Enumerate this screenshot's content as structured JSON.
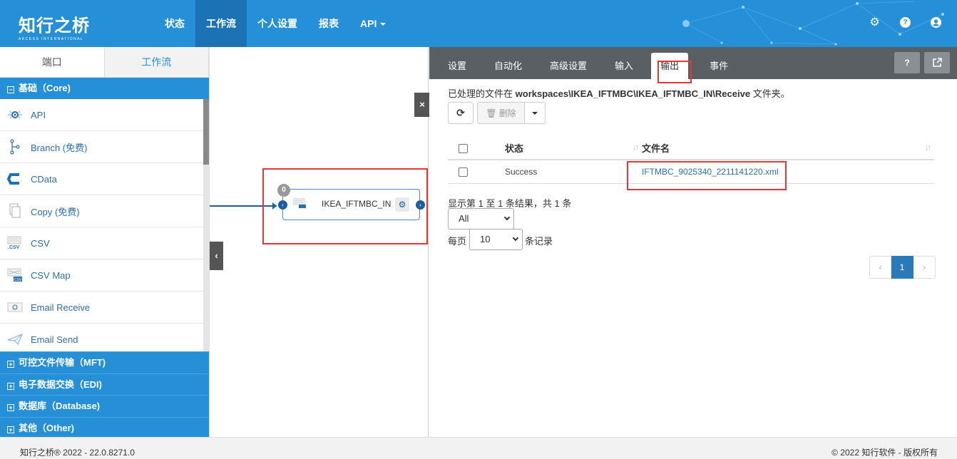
{
  "brand": {
    "name_cn": "知行之桥",
    "name_en": "AKCESS INTERNATIONAL"
  },
  "nav": {
    "items": [
      {
        "label": "状态"
      },
      {
        "label": "工作流"
      },
      {
        "label": "个人设置"
      },
      {
        "label": "报表"
      },
      {
        "label": "API"
      }
    ],
    "active": "工作流",
    "icons": [
      "gear-icon",
      "help-icon",
      "user-icon"
    ]
  },
  "left": {
    "tabs": [
      {
        "label": "端口"
      },
      {
        "label": "工作流"
      }
    ],
    "core_group": "基础（Core)",
    "items": [
      {
        "label": "API",
        "icon": "api-icon"
      },
      {
        "label": "Branch (免费)",
        "icon": "branch-icon"
      },
      {
        "label": "CData",
        "icon": "cdata-icon"
      },
      {
        "label": "Copy (免费)",
        "icon": "copy-icon"
      },
      {
        "label": "CSV",
        "icon": "csv-icon"
      },
      {
        "label": "CSV Map",
        "icon": "csv-map-icon"
      },
      {
        "label": "Email Receive",
        "icon": "email-receive-icon"
      },
      {
        "label": "Email Send",
        "icon": "email-send-icon"
      }
    ],
    "groups": [
      {
        "label": "可控文件传输（MFT)"
      },
      {
        "label": "电子数据交换（EDI)"
      },
      {
        "label": "数据库（Database)"
      },
      {
        "label": "其他（Other)"
      }
    ]
  },
  "canvas": {
    "close_label": "×",
    "node": {
      "label": "IKEA_IFTMBC_IN",
      "badge": "0"
    }
  },
  "right": {
    "tabs": [
      {
        "label": "设置"
      },
      {
        "label": "自动化"
      },
      {
        "label": "高级设置"
      },
      {
        "label": "输入"
      },
      {
        "label": "输出"
      },
      {
        "label": "事件"
      }
    ],
    "active_tab": "输出",
    "path_prefix": "已处理的文件在",
    "path_value": "workspaces\\IKEA_IFTMBC\\IKEA_IFTMBC_IN\\Receive",
    "path_suffix": "文件夹。",
    "delete_label": "删除",
    "table": {
      "headers": {
        "status": "状态",
        "filename": "文件名"
      },
      "rows": [
        {
          "status": "Success",
          "filename": "IFTMBC_9025340_2211141220.xml"
        }
      ]
    },
    "summary": "显示第 1 至 1 条结果，共 1 条",
    "filter_value": "All",
    "per_page_prefix": "每页",
    "per_page_value": "10",
    "per_page_suffix": "条记录",
    "pager": {
      "prev": "‹",
      "current": "1",
      "next": "›"
    }
  },
  "footer": {
    "left": "知行之桥® 2022 - 22.0.8271.0",
    "right": "© 2022 知行软件 - 版权所有"
  },
  "colors": {
    "brand": "#2590d8",
    "highlight": "#e53935",
    "tabbar": "#5a5f64"
  }
}
